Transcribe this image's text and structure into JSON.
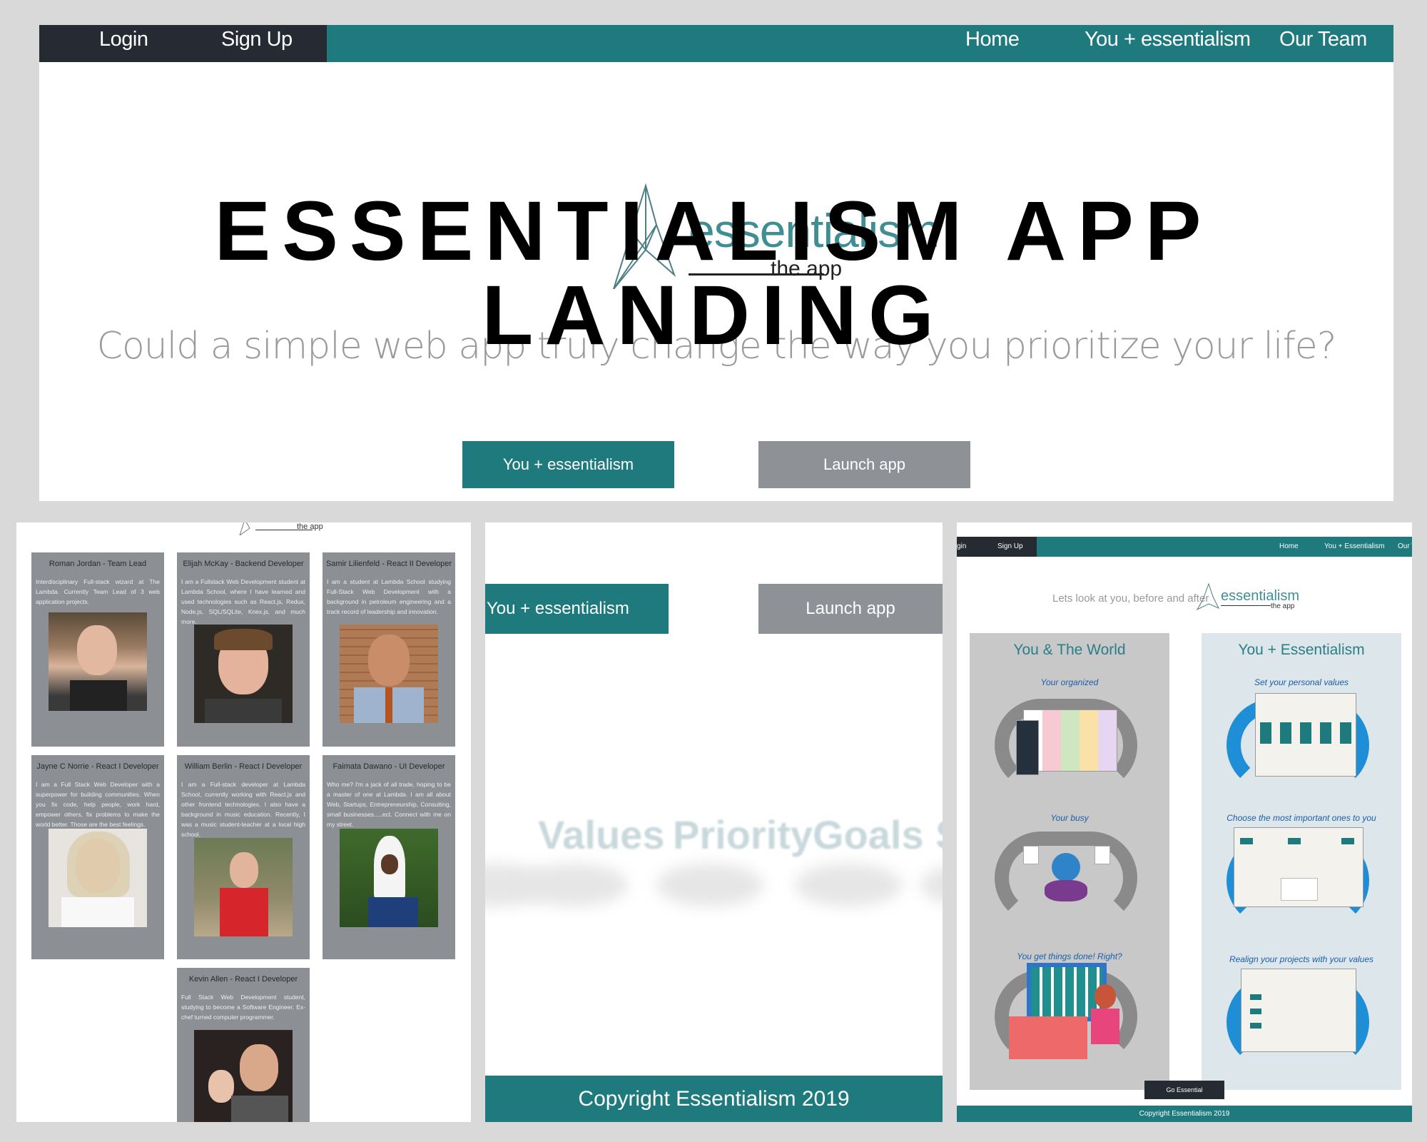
{
  "overlay_title": [
    "ESSENTIALISM APP",
    "LANDING"
  ],
  "hero": {
    "nav_left": [
      "Login",
      "Sign Up"
    ],
    "nav_right": [
      "Home",
      "You + essentialism",
      "Our Team"
    ],
    "logo_word": "essentialism",
    "logo_sub": "the app",
    "tagline": "Could a simple web app truly change the way you prioritize your life?",
    "btn_you": "You + essentialism",
    "btn_launch": "Launch app"
  },
  "team": {
    "header_logo_sub": "the app",
    "members": [
      {
        "name": "Roman Jordan - Team Lead",
        "bio": "Interdisciplinary Full-stack wizard at The Lambda. Currently Team Lead of 3 web application projects."
      },
      {
        "name": "Elijah McKay - Backend Developer",
        "bio": "I am a Fullstack Web Development student at Lambda School, where I have learned and used technologies such as React.js, Redux, Node.js, SQL/SQLite, Knex.js, and much more."
      },
      {
        "name": "Samir Lilienfeld - React II Developer",
        "bio": "I am a student at Lambda School studying Full-Stack Web Development with a background in petroleum engineering and a track record of leadership and innovation."
      },
      {
        "name": "Jayne C Norrie - React I Developer",
        "bio": "I am a Full Stack Web Developer with a superpower for building communities. When you fix code, help people, work hard, empower others, fix problems to make the world better. Those are the best feelings."
      },
      {
        "name": "William Berlin - React I Developer",
        "bio": "I am a Full-stack developer at Lambda School, currently working with React.js and other frontend technologies. I also have a background in music education. Recently, I was a music student-teacher at a local high school."
      },
      {
        "name": "Faimata Dawano - UI Developer",
        "bio": "Who me? I'm a jack of all trade, hoping to be a master of one at Lambda. I am all about Web, Startups, Entrepreneurship, Consulting, small businesses.....ect. Connect with me on my street."
      },
      {
        "name": "Kevin Allen - React I Developer",
        "bio": "Full Stack Web Development student, studying to become a Software Engineer. Ex-chef turned computer programmer."
      }
    ]
  },
  "mid": {
    "btn_you": "You + essentialism",
    "btn_launch": "Launch app",
    "words": [
      "Values",
      "Priority",
      "Goals",
      "S"
    ],
    "footer": "Copyright Essentialism 2019"
  },
  "right": {
    "nav_left": [
      "gin",
      "Sign Up"
    ],
    "nav_right": [
      "Home",
      "You + Essentialism",
      "Our T"
    ],
    "intro": "Lets look at you, before and after",
    "logo_word": "essentialism",
    "logo_sub": "the app",
    "left_title": "You & The World",
    "left_steps": [
      "Your organized",
      "Your busy",
      "You get things done! Right?"
    ],
    "right_title": "You + Essentialism",
    "right_steps": [
      "Set your personal values",
      "Choose the most important ones to you",
      "Realign your projects with your values"
    ],
    "go_button": "Go Essential",
    "footer": "Copyright Essentialism 2019"
  },
  "colors": {
    "teal": "#1f7a7d",
    "dark": "#262a33",
    "gray_button": "#8e9196",
    "cloud_gray": "#8a8a8a",
    "cloud_blue": "#1e8fd6"
  }
}
